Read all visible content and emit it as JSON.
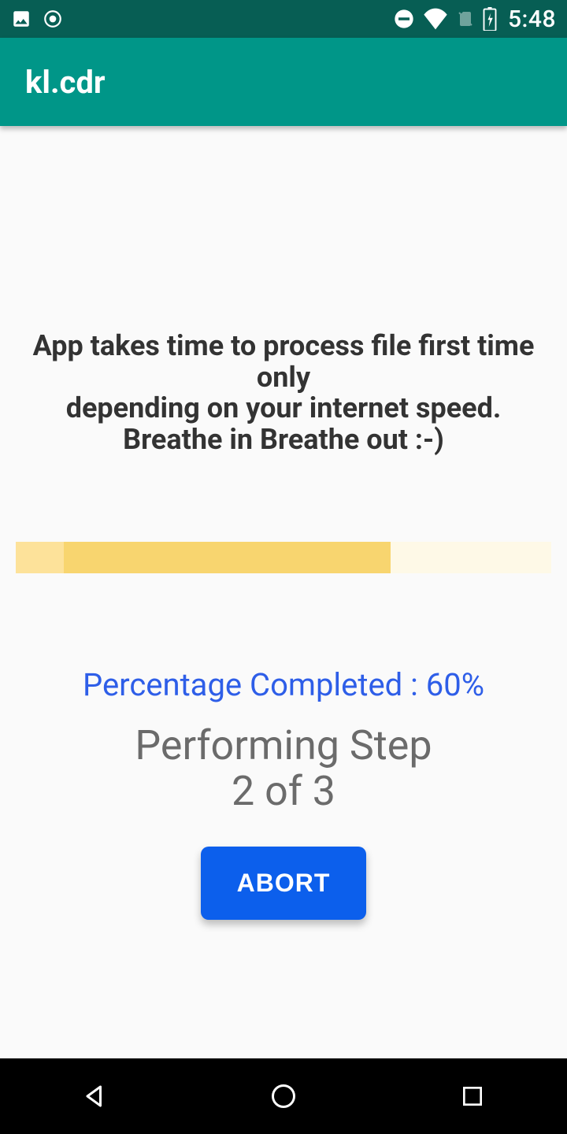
{
  "status": {
    "time": "5:48"
  },
  "header": {
    "title": "kl.cdr"
  },
  "main": {
    "info_line1": "App takes time to process file first time only",
    "info_line2": "depending on your internet speed.",
    "info_line3": "Breathe in Breathe out :-)",
    "percent_label": "Percentage Completed : 60%",
    "step_line1": "Performing Step",
    "step_line2": "2 of 3",
    "abort_label": "ABORT",
    "progress_percent": 60
  },
  "colors": {
    "status_bar": "#075e54",
    "app_bar": "#009688",
    "accent": "#0c5fec",
    "progress_fill": "#f8d56f",
    "progress_track": "#fef9e7"
  }
}
